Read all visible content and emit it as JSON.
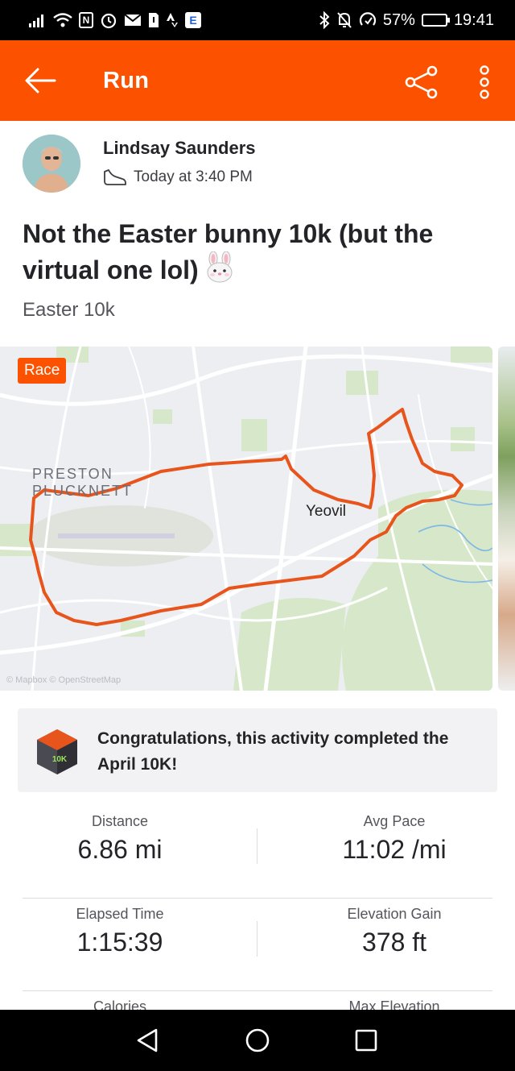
{
  "status_bar": {
    "battery_text": "57%",
    "battery_level": 0.57,
    "time": "19:41",
    "left_icons": [
      "signal-icon",
      "wifi-icon",
      "nfc-icon",
      "alarm-icon",
      "mail-icon",
      "sim-icon",
      "strava-notification-icon",
      "app-notification-icon"
    ],
    "right_icons": [
      "bluetooth-icon",
      "silent-icon",
      "data-saver-icon",
      "battery-icon"
    ]
  },
  "app_bar": {
    "title": "Run",
    "back_icon": "back-arrow-icon",
    "share_icon": "share-icon",
    "more_icon": "more-vertical-icon",
    "color": "#fc5200"
  },
  "athlete": {
    "name": "Lindsay Saunders",
    "time": "Today at 3:40 PM",
    "activity_icon": "shoe-icon"
  },
  "activity": {
    "title": "Not the Easter bunny 10k (but the virtual one lol)",
    "title_emoji_icon": "bunny-face-icon",
    "subtitle": "Easter 10k"
  },
  "map": {
    "badge": "Race",
    "label_area": "PRESTON",
    "label_area_2": "PLUCKNETT",
    "label_town": "Yeovil",
    "attribution": "© Mapbox © OpenStreetMap",
    "route_color": "#e8551c"
  },
  "challenge": {
    "badge_text": "10K",
    "text": "Congratulations, this activity completed the April 10K!"
  },
  "stats": [
    {
      "left": {
        "label": "Distance",
        "value": "6.86 mi"
      },
      "right": {
        "label": "Avg Pace",
        "value": "11:02 /mi"
      }
    },
    {
      "left": {
        "label": "Elapsed Time",
        "value": "1:15:39"
      },
      "right": {
        "label": "Elevation Gain",
        "value": "378 ft"
      }
    },
    {
      "left": {
        "label": "Calories",
        "value": ""
      },
      "right": {
        "label": "Max Elevation",
        "value": ""
      }
    }
  ],
  "nav": {
    "back_icon": "nav-back-icon",
    "home_icon": "nav-home-icon",
    "recents_icon": "nav-recents-icon"
  }
}
